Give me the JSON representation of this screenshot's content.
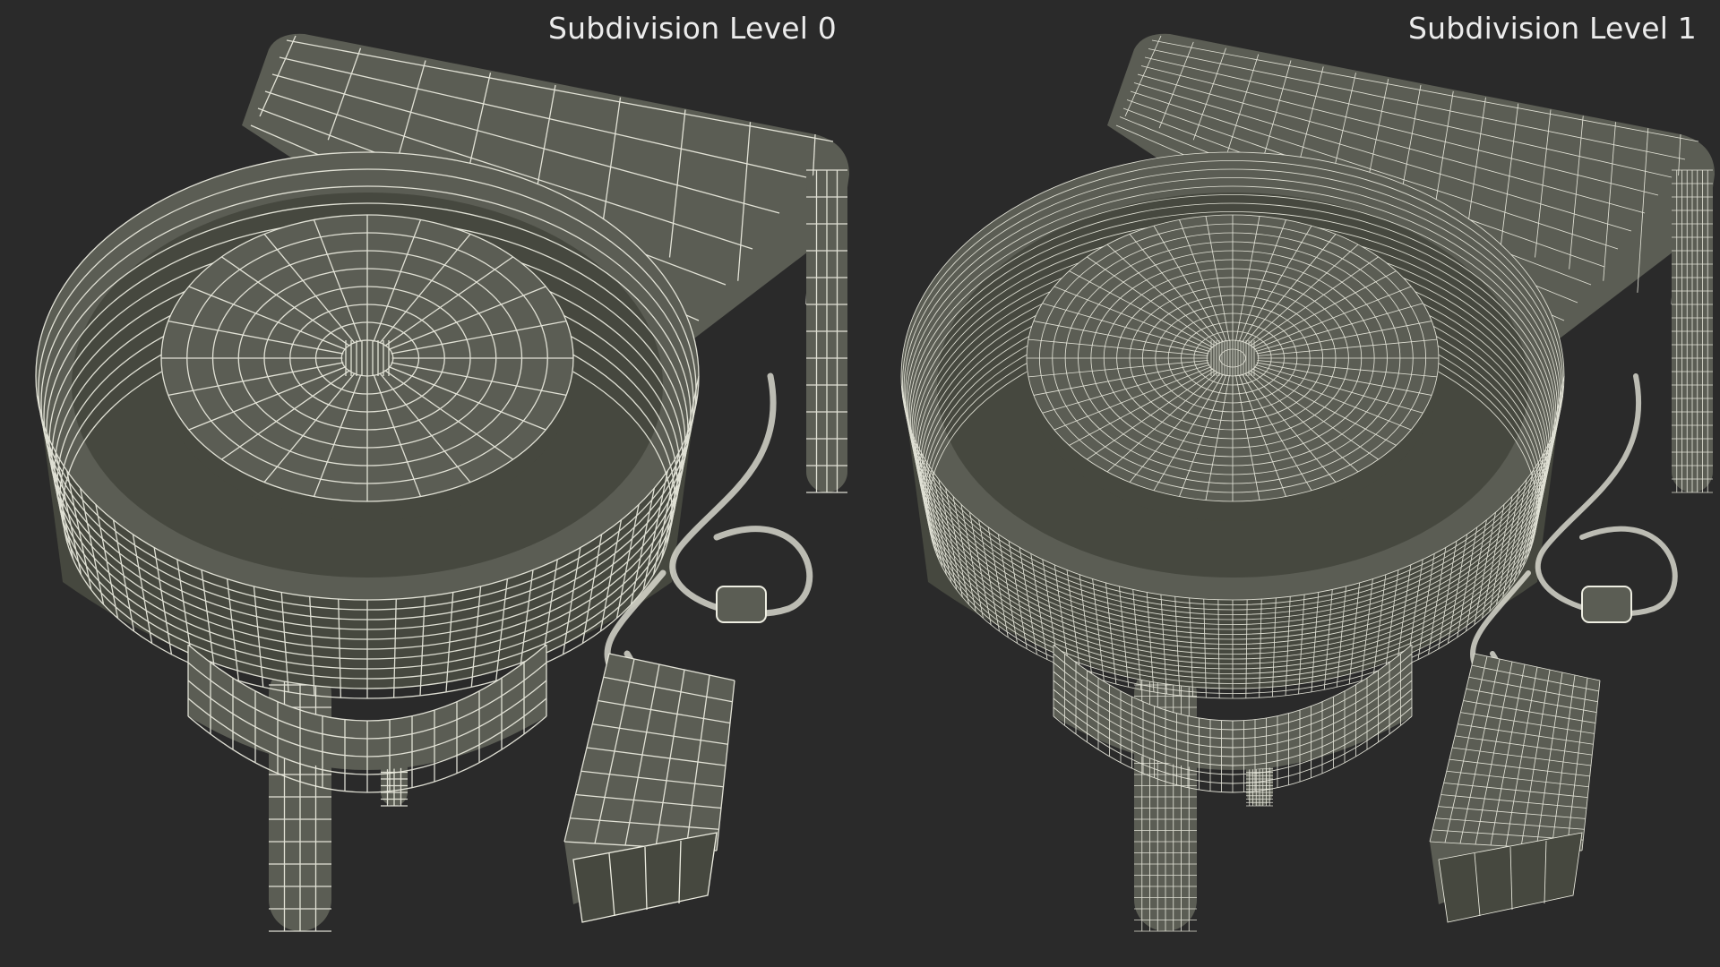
{
  "scene": {
    "background": "#2a2a2a",
    "mesh_fill": "#5b5d54",
    "mesh_shade": "#46483f",
    "wire_color": "#eeeee2",
    "panels": [
      {
        "label": "Subdivision Level 0",
        "subdivision_level": 0,
        "icon": "pottery-wheel-wireframe"
      },
      {
        "label": "Subdivision Level 1",
        "subdivision_level": 1,
        "icon": "pottery-wheel-wireframe"
      }
    ]
  }
}
